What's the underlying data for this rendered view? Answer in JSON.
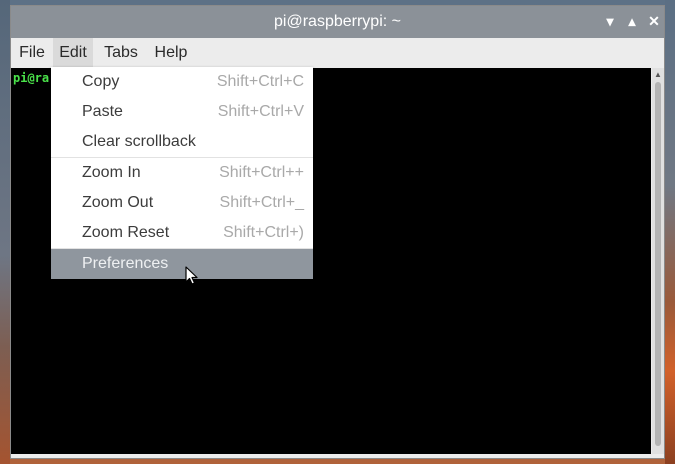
{
  "window": {
    "title": "pi@raspberrypi: ~",
    "buttons": {
      "minimize_icon": "▾",
      "maximize_icon": "▴",
      "close_icon": "✕"
    }
  },
  "menubar": {
    "items": [
      {
        "label": "File"
      },
      {
        "label": "Edit"
      },
      {
        "label": "Tabs"
      },
      {
        "label": "Help"
      }
    ]
  },
  "terminal": {
    "prompt": "pi@ra"
  },
  "edit_menu": {
    "items": [
      {
        "label": "Copy",
        "shortcut": "Shift+Ctrl+C"
      },
      {
        "label": "Paste",
        "shortcut": "Shift+Ctrl+V"
      },
      {
        "label": "Clear scrollback",
        "shortcut": ""
      },
      {
        "label": "Zoom In",
        "shortcut": "Shift+Ctrl++"
      },
      {
        "label": "Zoom Out",
        "shortcut": "Shift+Ctrl+_"
      },
      {
        "label": "Zoom Reset",
        "shortcut": "Shift+Ctrl+)"
      },
      {
        "label": "Preferences",
        "shortcut": ""
      }
    ],
    "highlighted": "Preferences"
  },
  "colors": {
    "titlebar": "#8b9198",
    "highlight": "#8f969e",
    "prompt_green": "#4ae24a",
    "terminal_bg": "#000000"
  }
}
